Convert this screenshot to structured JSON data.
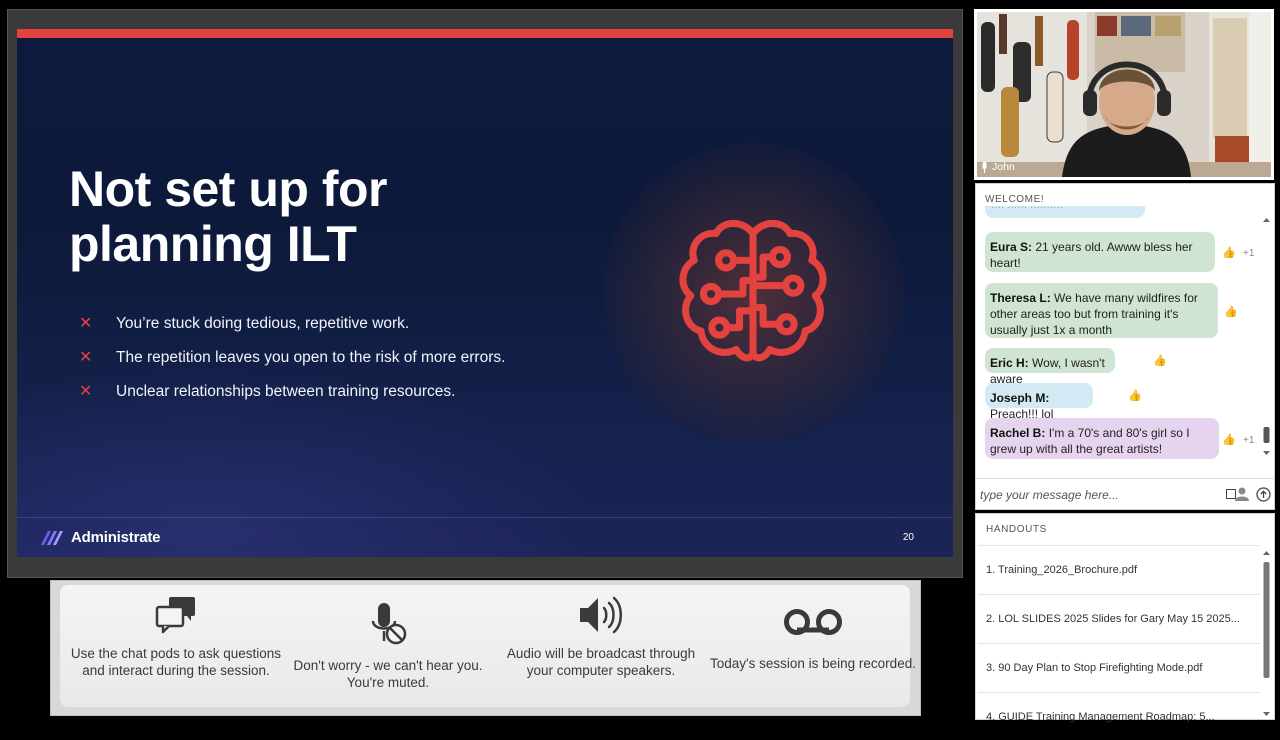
{
  "slide": {
    "title": "Not set up for planning ILT",
    "bullets": [
      "You’re stuck doing tedious, repetitive work.",
      "The repetition leaves you open to the risk of more errors.",
      "Unclear relationships between training resources."
    ],
    "bullet_marker": "✕",
    "brand_name": "Administrate",
    "page_number": "20",
    "accent_color": "#e3423f"
  },
  "tips": [
    {
      "icon": "chat-bubbles-icon",
      "text": "Use the chat pods to ask questions and interact during the session."
    },
    {
      "icon": "muted-microphone-icon",
      "text": "Don't worry - we can't hear you. You're muted."
    },
    {
      "icon": "speaker-icon",
      "text": "Audio will be broadcast through your computer speakers."
    },
    {
      "icon": "voicemail-recording-icon",
      "text": "Today's session is being recorded."
    }
  ],
  "video": {
    "participant_name": "John"
  },
  "chat": {
    "title": "WELCOME!",
    "partial_top_message": "···· ······ ··········",
    "messages": [
      {
        "author": "Eura S:",
        "text": "21 years old. Awww bless her heart!",
        "likes": "+1",
        "color": "#cfe4d3"
      },
      {
        "author": "Theresa L:",
        "text": "We have many wildfires for other areas too but from training it's usually just 1x a month",
        "likes": "",
        "color": "#cfe4d3"
      },
      {
        "author": "Eric H:",
        "text": "Wow, I wasn't aware",
        "likes": "",
        "color": "#cfe4d3"
      },
      {
        "author": "Joseph M:",
        "text": "Preach!!! lol",
        "likes": "",
        "color": "#d3e9f3"
      },
      {
        "author": "Rachel B:",
        "text": "I'm a 70's and 80's girl so I grew up with all the great artists!",
        "likes": "+1",
        "color": "#e6d4ef"
      }
    ],
    "input_placeholder": "type your message here..."
  },
  "handouts": {
    "title": "HANDOUTS",
    "items": [
      "1. Training_2026_Brochure.pdf",
      "2. LOL SLIDES 2025 Slides for Gary May 15 2025...",
      "3. 90 Day Plan to Stop Firefighting Mode.pdf",
      "4. GUIDE Training Management Roadmap: 5..."
    ]
  }
}
